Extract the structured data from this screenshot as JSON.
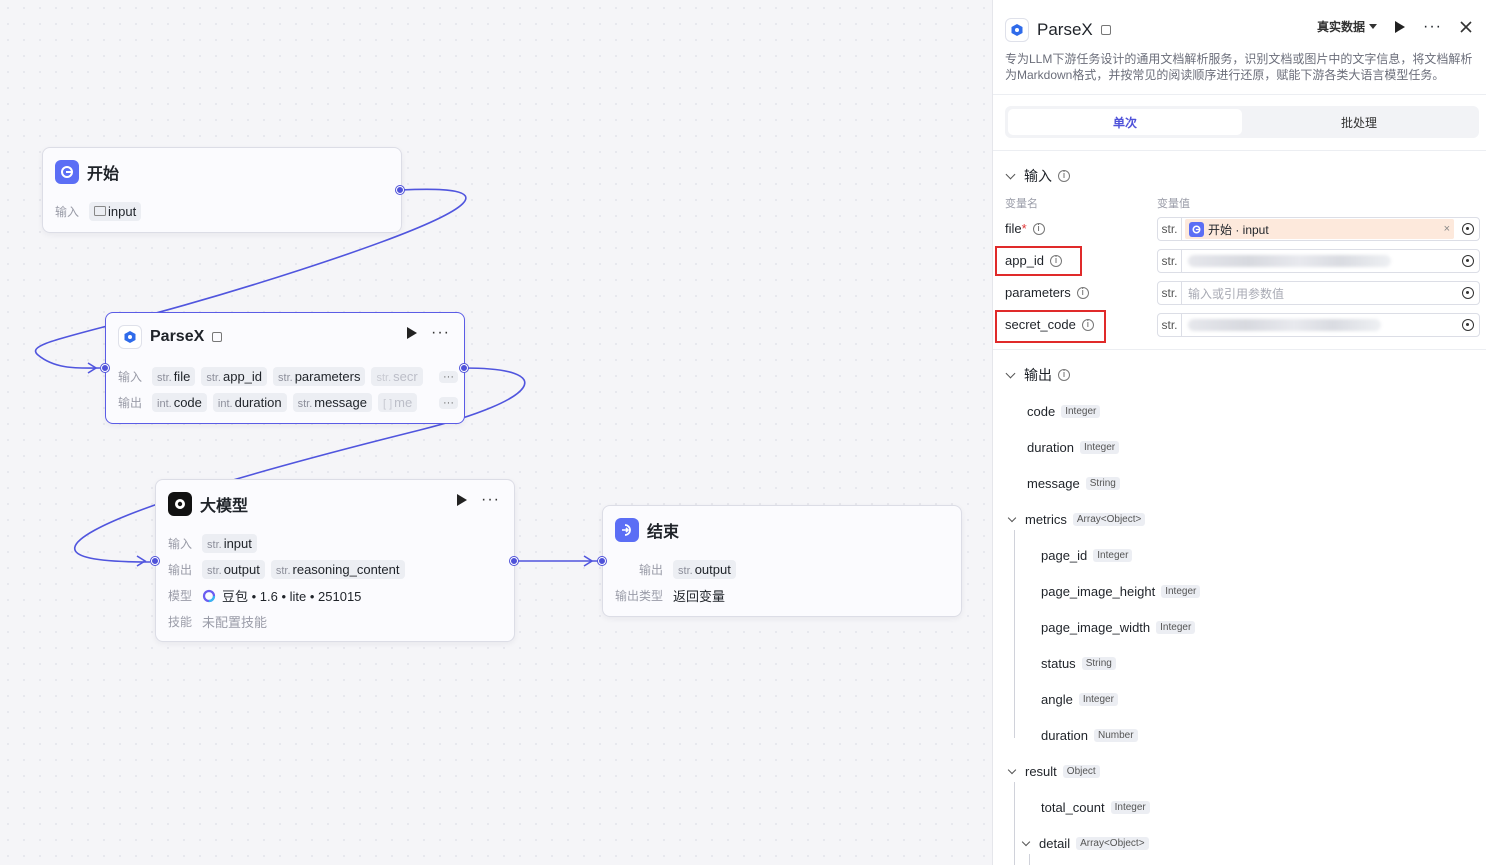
{
  "canvas": {
    "start_node": {
      "title": "开始",
      "input_label": "输入",
      "input_var": "input"
    },
    "parsex_node": {
      "title": "ParseX",
      "input_label": "输入",
      "output_label": "输出",
      "inputs": [
        {
          "type": "str.",
          "name": "file"
        },
        {
          "type": "str.",
          "name": "app_id"
        },
        {
          "type": "str.",
          "name": "parameters"
        },
        {
          "type": "str.",
          "name": "secr"
        }
      ],
      "outputs": [
        {
          "type": "int.",
          "name": "code"
        },
        {
          "type": "int.",
          "name": "duration"
        },
        {
          "type": "str.",
          "name": "message"
        },
        {
          "type": "[ ]",
          "name": "me"
        }
      ],
      "more": "···"
    },
    "llm_node": {
      "title": "大模型",
      "input_label": "输入",
      "output_label": "输出",
      "model_label": "模型",
      "skill_label": "技能",
      "input": {
        "type": "str.",
        "name": "input"
      },
      "outputs": [
        {
          "type": "str.",
          "name": "output"
        },
        {
          "type": "str.",
          "name": "reasoning_content"
        }
      ],
      "model": "豆包 • 1.6 • lite • 251015",
      "skill": "未配置技能"
    },
    "end_node": {
      "title": "结束",
      "output_label": "输出",
      "output": {
        "type": "str.",
        "name": "output"
      },
      "output_type_label": "输出类型",
      "output_type": "返回变量"
    }
  },
  "panel": {
    "title": "ParseX",
    "data_mode": "真实数据",
    "description": "专为LLM下游任务设计的通用文档解析服务，识别文档或图片中的文字信息，将文档解析为Markdown格式，并按常见的阅读顺序进行还原，赋能下游各类大语言模型任务。",
    "tabs": [
      "单次",
      "批处理"
    ],
    "input_section": "输入",
    "col_name": "变量名",
    "col_value": "变量值",
    "params": [
      {
        "name": "file",
        "type": "str.",
        "ref": "开始 · input"
      },
      {
        "name": "app_id",
        "type": "str."
      },
      {
        "name": "parameters",
        "type": "str.",
        "placeholder": "输入或引用参数值"
      },
      {
        "name": "secret_code",
        "type": "str."
      }
    ],
    "output_section": "输出",
    "outputs": [
      {
        "name": "code",
        "type": "Integer"
      },
      {
        "name": "duration",
        "type": "Integer"
      },
      {
        "name": "message",
        "type": "String"
      },
      {
        "name": "metrics",
        "type": "Array<Object>"
      },
      {
        "name": "page_id",
        "type": "Integer"
      },
      {
        "name": "page_image_height",
        "type": "Integer"
      },
      {
        "name": "page_image_width",
        "type": "Integer"
      },
      {
        "name": "status",
        "type": "String"
      },
      {
        "name": "angle",
        "type": "Integer"
      },
      {
        "name": "duration",
        "type": "Number"
      },
      {
        "name": "result",
        "type": "Object"
      },
      {
        "name": "total_count",
        "type": "Integer"
      },
      {
        "name": "detail",
        "type": "Array<Object>"
      }
    ]
  },
  "colors": {
    "accent": "#4f52d9",
    "highlight": "#e02a2a",
    "ref_bg": "#fde9dc"
  }
}
